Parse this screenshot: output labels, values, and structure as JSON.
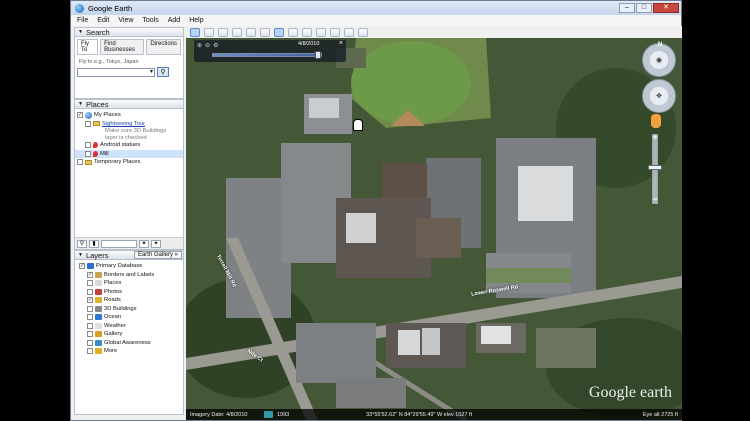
{
  "window": {
    "title": "Google Earth",
    "buttons": {
      "minimize": "–",
      "maximize": "□",
      "close": "✕"
    }
  },
  "menu": [
    "File",
    "Edit",
    "View",
    "Tools",
    "Add",
    "Help"
  ],
  "toolbar": {
    "buttons": [
      "sidebar-toggle",
      "placemark",
      "polygon",
      "path",
      "image-overlay",
      "record-tour",
      "historical-imagery",
      "sun",
      "planets",
      "ruler",
      "email",
      "print",
      "view-in-maps"
    ]
  },
  "search": {
    "header": "Search",
    "tabs": [
      "Fly To",
      "Find Businesses",
      "Directions"
    ],
    "hint": "Fly to e.g., Tokyo, Japan",
    "value": ""
  },
  "places": {
    "header": "Places",
    "items": [
      {
        "label": "My Places",
        "kind": "globe",
        "checked": true
      },
      {
        "label": "Sightseeing Tour",
        "kind": "folder",
        "link": true
      },
      {
        "label": "Make sure 3D Buildings layer is checked",
        "kind": "note"
      },
      {
        "label": "Android statues",
        "kind": "pin"
      },
      {
        "label": "Mill",
        "kind": "pin",
        "selected": true
      },
      {
        "label": "Temporary Places",
        "kind": "folder"
      }
    ]
  },
  "layers": {
    "header": "Layers",
    "gallery_button": "Earth Gallery »",
    "items": [
      {
        "label": "Primary Database",
        "checked": true,
        "color": "#2e6dd2"
      },
      {
        "label": "Borders and Labels",
        "checked": true,
        "color": "#c8a248"
      },
      {
        "label": "Places",
        "checked": false,
        "color": "#d9d9d9"
      },
      {
        "label": "Photos",
        "checked": false,
        "color": "#c24040"
      },
      {
        "label": "Roads",
        "checked": true,
        "color": "#e3b12c"
      },
      {
        "label": "3D Buildings",
        "checked": false,
        "color": "#888888"
      },
      {
        "label": "Ocean",
        "checked": false,
        "color": "#2b7ad1"
      },
      {
        "label": "Weather",
        "checked": false,
        "color": "#e0e0e0"
      },
      {
        "label": "Gallery",
        "checked": false,
        "color": "#d8a020"
      },
      {
        "label": "Global Awareness",
        "checked": false,
        "color": "#3c8ac4"
      },
      {
        "label": "More",
        "checked": false,
        "color": "#e0b020"
      }
    ]
  },
  "timeslider": {
    "date": "4/8/2010"
  },
  "navigation": {
    "north_label": "N"
  },
  "map": {
    "road_labels": [
      "Lower Roswell Rd",
      "Terrell Mill Rd",
      "Nite Ct"
    ],
    "logo": "Google earth"
  },
  "status": {
    "imagery_date": "Imagery Date: 4/8/2010",
    "year": "1993",
    "coordinates": "33°55'52.62\" N  84°29'55.49\" W  elev  1027 ft",
    "eye_alt": "Eye alt  2725 ft"
  }
}
